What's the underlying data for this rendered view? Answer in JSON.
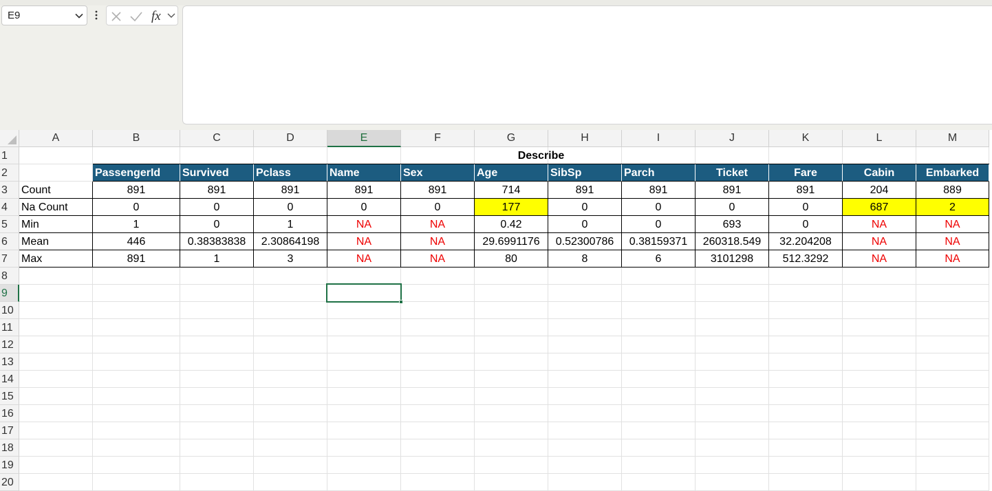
{
  "name_box": {
    "value": "E9"
  },
  "formula_bar": {
    "value": ""
  },
  "columns": [
    "A",
    "B",
    "C",
    "D",
    "E",
    "F",
    "G",
    "H",
    "I",
    "J",
    "K",
    "L",
    "M"
  ],
  "selected_column": "E",
  "rows": [
    "1",
    "2",
    "3",
    "4",
    "5",
    "6",
    "7",
    "8",
    "9",
    "10",
    "11",
    "12",
    "13",
    "14",
    "15",
    "16",
    "17",
    "18",
    "19",
    "20"
  ],
  "selected_row": "9",
  "sheet": {
    "title": "Describe",
    "headers": [
      "PassengerId",
      "Survived",
      "Pclass",
      "Name",
      "Sex",
      "Age",
      "SibSp",
      "Parch",
      "Ticket",
      "Fare",
      "Cabin",
      "Embarked"
    ],
    "stats": [
      {
        "label": "Count",
        "values": [
          "891",
          "891",
          "891",
          "891",
          "891",
          "714",
          "891",
          "891",
          "891",
          "891",
          "204",
          "889"
        ]
      },
      {
        "label": "Na Count",
        "values": [
          "0",
          "0",
          "0",
          "0",
          "0",
          "177",
          "0",
          "0",
          "0",
          "0",
          "687",
          "2"
        ]
      },
      {
        "label": "Min",
        "values": [
          "1",
          "0",
          "1",
          "NA",
          "NA",
          "0.42",
          "0",
          "0",
          "693",
          "0",
          "NA",
          "NA"
        ]
      },
      {
        "label": "Mean",
        "values": [
          "446",
          "0.38383838",
          "2.30864198",
          "NA",
          "NA",
          "29.6991176",
          "0.52300786",
          "0.38159371",
          "260318.549",
          "32.204208",
          "NA",
          "NA"
        ]
      },
      {
        "label": "Max",
        "values": [
          "891",
          "1",
          "3",
          "NA",
          "NA",
          "80",
          "8",
          "6",
          "3101298",
          "512.3292",
          "NA",
          "NA"
        ]
      }
    ]
  },
  "highlight_color": "#ffff00",
  "header_fill_color": "#1c5c80",
  "na_text_color": "#ee0000"
}
